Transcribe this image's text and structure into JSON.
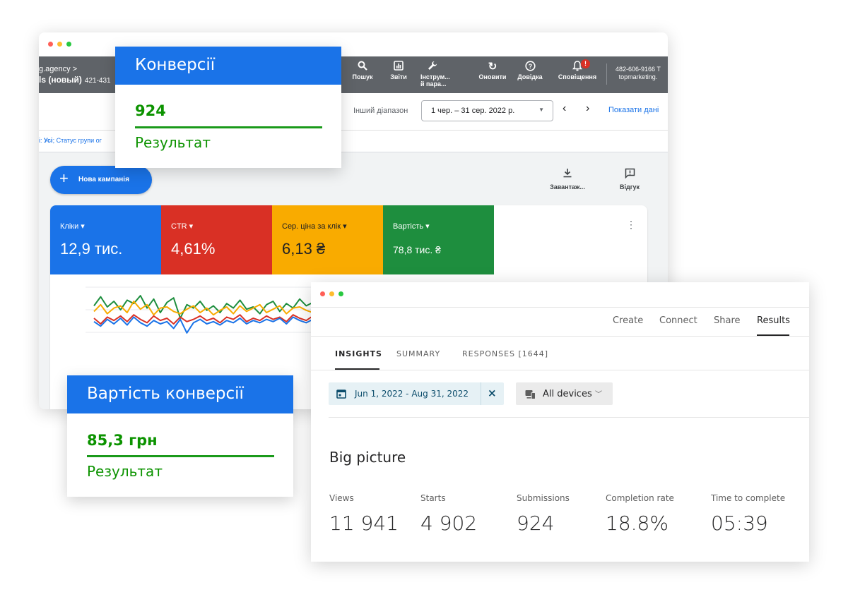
{
  "colors": {
    "accent_blue": "#1a73e8",
    "metric_blue": "#1a73e8",
    "metric_red": "#d93025",
    "metric_yellow": "#f9ab00",
    "metric_green": "#1e8e3e",
    "result_green": "#0c9300"
  },
  "ads": {
    "account": {
      "line1": "g.agency  >",
      "name": "ls (новый)",
      "id": "421-431"
    },
    "toolbar": [
      {
        "icon": "search-icon",
        "label": "Пошук"
      },
      {
        "icon": "reports-icon",
        "label": "Звіти"
      },
      {
        "icon": "wrench-icon",
        "label": "Інструм...\nй пара..."
      },
      {
        "icon": "refresh-icon",
        "label": "Оновити"
      },
      {
        "icon": "help-icon",
        "label": "Довідка"
      },
      {
        "icon": "bell-icon",
        "label": "Сповіщення",
        "badge": "!"
      }
    ],
    "phone": "482-606-9166 T",
    "site": "topmarketing.",
    "range_label": "Інший діапазон",
    "date_range": "1 чер. – 31 сер. 2022 р.",
    "show_data": "Показати дані",
    "filter_prefix": "і: ",
    "filter_all": "Усі",
    "filter_rest": "; Статус групи ог",
    "new_campaign": "Нова кампанія",
    "download": "Завантаж...",
    "feedback": "Відгук",
    "metrics": [
      {
        "label": "Кліки",
        "value": "12,9 тис."
      },
      {
        "label": "CTR",
        "value": "4,61%"
      },
      {
        "label": "Сер. ціна за клік",
        "value": "6,13 ₴"
      },
      {
        "label": "Вартість",
        "value": "78,8 тис. ₴"
      }
    ]
  },
  "chart_data": {
    "type": "line",
    "title": "",
    "xlabel": "",
    "ylabel": "",
    "grid": true,
    "series": [
      {
        "color": "#1e8e3e",
        "values": [
          62,
          78,
          60,
          70,
          55,
          72,
          66,
          80,
          58,
          74,
          50,
          68,
          76,
          40,
          64,
          58,
          70,
          54,
          62,
          50,
          66,
          58,
          72,
          56,
          60,
          48,
          64,
          70,
          52,
          66,
          58,
          74,
          62,
          68,
          56,
          72,
          60
        ]
      },
      {
        "color": "#f9ab00",
        "values": [
          52,
          64,
          48,
          58,
          62,
          50,
          70,
          56,
          64,
          46,
          58,
          60,
          52,
          48,
          56,
          62,
          50,
          58,
          46,
          54,
          60,
          48,
          62,
          52,
          58,
          64,
          50,
          56,
          62,
          48,
          58,
          60,
          54,
          50,
          66,
          56,
          62
        ]
      },
      {
        "color": "#d93025",
        "values": [
          40,
          30,
          42,
          36,
          44,
          34,
          46,
          38,
          32,
          44,
          36,
          40,
          30,
          42,
          34,
          38,
          44,
          36,
          40,
          32,
          42,
          38,
          46,
          34,
          40,
          36,
          44,
          38,
          42,
          34,
          46,
          40,
          36,
          44,
          38,
          42,
          40
        ]
      },
      {
        "color": "#1a73e8",
        "values": [
          34,
          26,
          38,
          30,
          40,
          28,
          42,
          32,
          26,
          36,
          30,
          34,
          22,
          38,
          14,
          32,
          38,
          30,
          34,
          28,
          36,
          32,
          40,
          30,
          36,
          32,
          38,
          34,
          40,
          30,
          42,
          36,
          32,
          38,
          34,
          36,
          32
        ]
      }
    ]
  },
  "callouts": {
    "conversions": {
      "title": "Конверсії",
      "value": "924",
      "result": "Результат"
    },
    "cost": {
      "title": "Вартість конверсії",
      "value": "85,3 грн",
      "result": "Результат"
    }
  },
  "forms": {
    "nav": [
      "Create",
      "Connect",
      "Share",
      "Results"
    ],
    "tabs": [
      "INSIGHTS",
      "SUMMARY",
      "RESPONSES [1644]"
    ],
    "date_filter": "Jun 1, 2022 - Aug 31, 2022",
    "devices": "All devices",
    "section_title": "Big picture",
    "stats": [
      {
        "label": "Views",
        "value": "11 941"
      },
      {
        "label": "Starts",
        "value": "4 902"
      },
      {
        "label": "Submissions",
        "value": "924"
      },
      {
        "label": "Completion rate",
        "value": "18.8%"
      },
      {
        "label": "Time to complete",
        "value": "05:39"
      }
    ]
  }
}
